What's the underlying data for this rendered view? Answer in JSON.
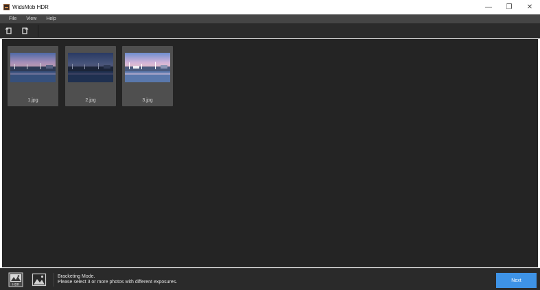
{
  "window": {
    "title": "WidsMob HDR",
    "controls": {
      "minimize": "—",
      "restore": "❐",
      "close": "✕"
    }
  },
  "menu": {
    "items": [
      "File",
      "View",
      "Help"
    ]
  },
  "toolbar": {
    "buttons": [
      "rotate-left-icon",
      "rotate-right-icon"
    ]
  },
  "photos": [
    {
      "label": "1.jpg",
      "exposure": "normal"
    },
    {
      "label": "2.jpg",
      "exposure": "dark"
    },
    {
      "label": "3.jpg",
      "exposure": "bright"
    }
  ],
  "bottom": {
    "status_line1": "Bracketing Mode.",
    "status_line2": "Please select 3 or more photos with different exposures.",
    "next_label": "Next",
    "hdr_badge": "HDR"
  },
  "colors": {
    "accent": "#3e93e6",
    "menubar": "#454545",
    "main_bg": "#242424",
    "thumb_bg": "#4f4f4f"
  }
}
